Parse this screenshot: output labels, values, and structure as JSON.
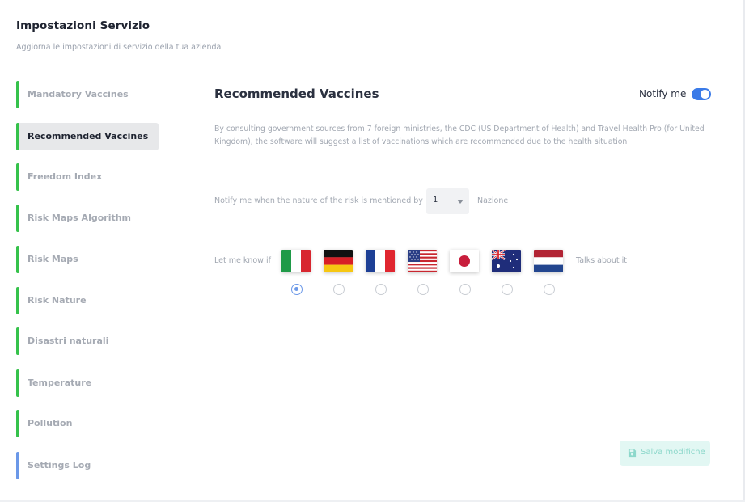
{
  "header": {
    "title": "Impostazioni Servizio",
    "subtitle": "Aggiorna le impostazioni di servizio della tua azienda"
  },
  "sidebar": {
    "items": [
      {
        "label": "Mandatory Vaccines",
        "active": false,
        "color": "#35c24b"
      },
      {
        "label": "Recommended Vaccines",
        "active": true,
        "color": "#35c24b"
      },
      {
        "label": "Freedom Index",
        "active": false,
        "color": "#35c24b"
      },
      {
        "label": "Risk Maps Algorithm",
        "active": false,
        "color": "#35c24b"
      },
      {
        "label": "Risk Maps",
        "active": false,
        "color": "#35c24b"
      },
      {
        "label": "Risk Nature",
        "active": false,
        "color": "#35c24b"
      },
      {
        "label": "Disastri naturali",
        "active": false,
        "color": "#35c24b"
      },
      {
        "label": "Temperature",
        "active": false,
        "color": "#35c24b"
      },
      {
        "label": "Pollution",
        "active": false,
        "color": "#35c24b"
      },
      {
        "label": "Settings Log",
        "active": false,
        "color": "#6b98e8"
      }
    ]
  },
  "main": {
    "title": "Recommended Vaccines",
    "notify_label": "Notify me",
    "notify_enabled": true,
    "description": "By consulting government sources from 7 foreign ministries, the CDC (US Department of Health) and Travel Health Pro (for United Kingdom), the software will suggest a list of vaccinations which are recommended due to the health situation",
    "notify_row": {
      "prefix": "Notify me when the nature of the risk is mentioned by",
      "selected_value": "1",
      "suffix": "Nazione"
    },
    "flags_row": {
      "prefix": "Let me know if",
      "suffix": "Talks about it",
      "flags": [
        {
          "icon": "italy-flag-icon",
          "selected": true
        },
        {
          "icon": "germany-flag-icon",
          "selected": false
        },
        {
          "icon": "france-flag-icon",
          "selected": false
        },
        {
          "icon": "usa-flag-icon",
          "selected": false
        },
        {
          "icon": "japan-flag-icon",
          "selected": false
        },
        {
          "icon": "australia-flag-icon",
          "selected": false
        },
        {
          "icon": "netherlands-flag-icon",
          "selected": false
        }
      ]
    },
    "save_label": "Salva modifiche",
    "save_icon": "floppy-disk-icon"
  },
  "colors": {
    "accent": "#3b7be8",
    "sidebar_indicator": "#35c24b",
    "log_indicator": "#6b98e8",
    "save_bg": "#e2f7f3",
    "save_text": "#8dd8cb"
  }
}
